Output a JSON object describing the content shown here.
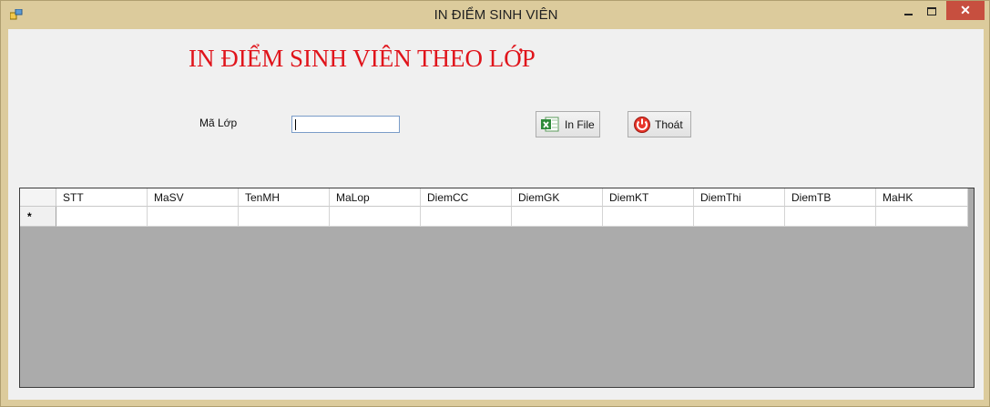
{
  "window": {
    "title": "IN ĐIỂM SINH VIÊN",
    "close_glyph": "✕"
  },
  "form": {
    "heading": "IN ĐIỂM SINH VIÊN THEO LỚP",
    "ma_lop_label": "Mã Lớp",
    "ma_lop_value": "",
    "in_file_label": "In File",
    "thoat_label": "Thoát"
  },
  "grid": {
    "columns": [
      "STT",
      "MaSV",
      "TenMH",
      "MaLop",
      "DiemCC",
      "DiemGK",
      "DiemKT",
      "DiemThi",
      "DiemTB",
      "MaHK"
    ],
    "new_row_marker": "*"
  },
  "icons": {
    "app": "app-window-icon",
    "in_file": "excel-icon",
    "thoat": "power-icon"
  }
}
